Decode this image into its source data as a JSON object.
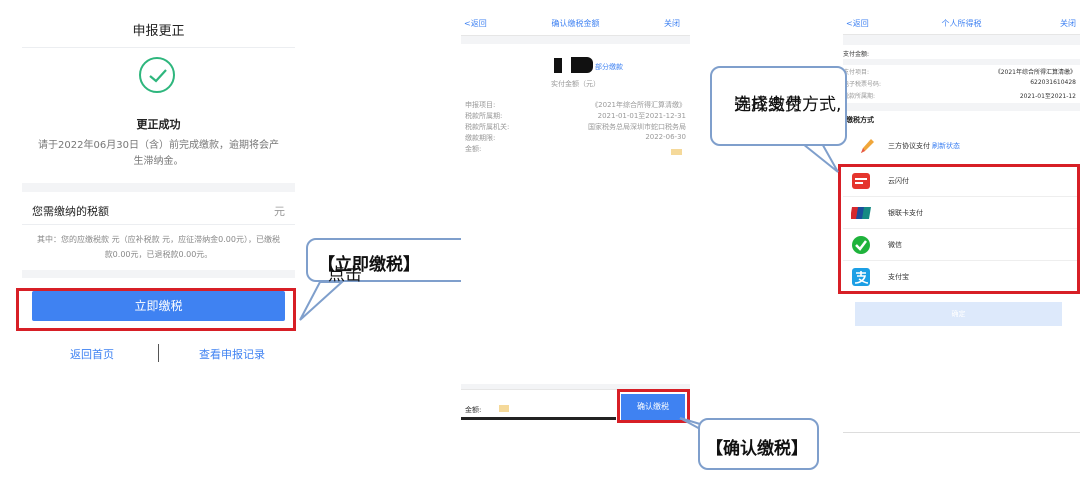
{
  "panel1": {
    "title": "申报更正",
    "success_title": "更正成功",
    "success_desc": "请于2022年06月30日（含）前完成缴款，逾期将会产生滞纳金。",
    "tax_label": "您需缴纳的税额",
    "tax_unit": "元",
    "tax_detail": "其中：您的应缴税款 元（应补税款 元，应征滞纳金0.00元），已缴税款0.00元，已退税款0.00元。",
    "pay_button": "立即缴税",
    "link_home": "返回首页",
    "link_records": "查看申报记录"
  },
  "callout1": {
    "prefix": "点击",
    "emphasis": "【立即缴税】"
  },
  "panel2": {
    "back": "<返回",
    "title": "确认缴税金额",
    "close": "关闭",
    "partial_pay": "部分缴款",
    "amount_label": "实付金额（元）",
    "rows": [
      {
        "key": "申报项目:",
        "value": "《2021年综合所得汇算清缴》"
      },
      {
        "key": "税款所属期:",
        "value": "2021-01-01至2021-12-31"
      },
      {
        "key": "税款所属机关:",
        "value": "国家税务总局深圳市蛇口税务局"
      },
      {
        "key": "缴款期限:",
        "value": "2022-06-30"
      },
      {
        "key": "金额:",
        "value": ""
      }
    ],
    "footer_label": "金额:",
    "confirm_button": "确认缴税"
  },
  "callout2": {
    "text": "【确认缴税】"
  },
  "panel3": {
    "back": "<返回",
    "title": "个人所得税",
    "close": "关闭",
    "pay_amount_label": "支付金额:",
    "pay_amount_value": "",
    "info_rows": [
      {
        "key": "支付项目:",
        "value": "《2021年综合所得汇算清缴》"
      },
      {
        "key": "电子税票号码:",
        "value": "622031610428"
      },
      {
        "key": "税款所属期:",
        "value": "2021-01至2021-12"
      }
    ],
    "method_title": "缴税方式",
    "three_party": "三方协议支付",
    "refresh": "刷新状态",
    "options": [
      {
        "label": "云闪付",
        "icon": "unionpay-quickpass-icon"
      },
      {
        "label": "银联卡支付",
        "icon": "unionpay-card-icon"
      },
      {
        "label": "微信",
        "icon": "wechat-icon"
      },
      {
        "label": "支付宝",
        "icon": "alipay-icon"
      }
    ],
    "confirm_button": "确定"
  },
  "callout3": {
    "line1": "选择缴费方式,",
    "line2": "完成支付"
  },
  "colors": {
    "accent_blue": "#3f82f2",
    "highlight_red": "#d71f26",
    "success_green": "#2eb67d",
    "callout_border": "#7f9fcc"
  }
}
